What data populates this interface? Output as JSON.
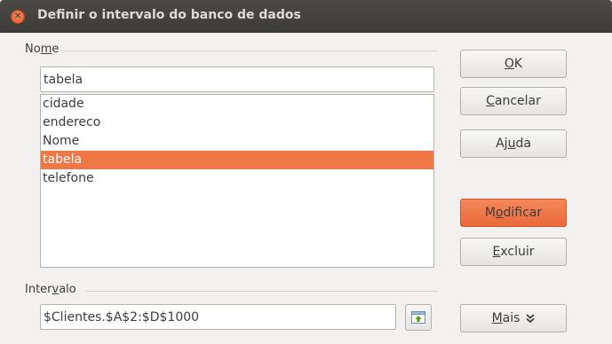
{
  "window": {
    "title": "Definir o intervalo do banco de dados",
    "close_icon": "close-icon"
  },
  "name_section": {
    "label_pre": "No",
    "label_mnemonic": "m",
    "label_post": "e",
    "input_value": "tabela",
    "list_items": [
      "cidade",
      "endereco",
      "Nome",
      "tabela",
      "telefone"
    ],
    "selected_item": "tabela"
  },
  "range_section": {
    "label_pre": "Inter",
    "label_mnemonic": "v",
    "label_post": "alo",
    "input_value": "$Clientes.$A$2:$D$1000",
    "shrink_icon": "shrink-selection-icon"
  },
  "buttons": {
    "ok": {
      "pre": "",
      "mnemonic": "O",
      "post": "K"
    },
    "cancel": {
      "pre": "",
      "mnemonic": "C",
      "post": "ancelar"
    },
    "help": {
      "pre": "Aj",
      "mnemonic": "u",
      "post": "da"
    },
    "modify": {
      "pre": "M",
      "mnemonic": "o",
      "post": "dificar"
    },
    "delete": {
      "pre": "",
      "mnemonic": "E",
      "post": "xcluir"
    },
    "more": {
      "pre": "",
      "mnemonic": "M",
      "post": "ais",
      "icon": "double-chevron-down-icon"
    }
  },
  "colors": {
    "accent": "#f07746",
    "titlebar": "#3c3b37"
  }
}
